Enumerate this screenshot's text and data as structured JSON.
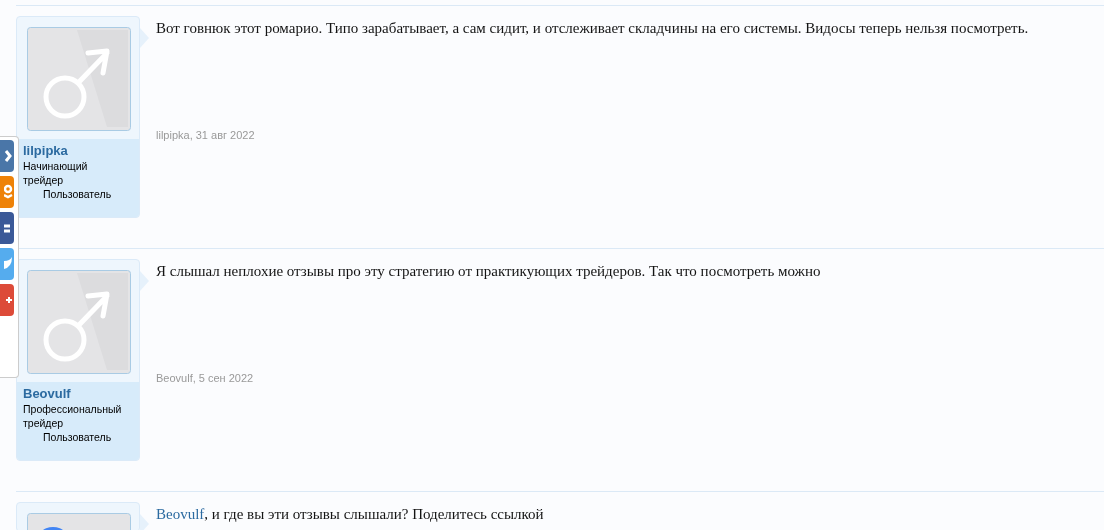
{
  "share_buttons": [
    {
      "kind": "vk",
      "color": "#4a76a8"
    },
    {
      "kind": "ok",
      "color": "#ee8208"
    },
    {
      "kind": "fb",
      "color": "#3b5998"
    },
    {
      "kind": "tw",
      "color": "#55acee"
    },
    {
      "kind": "gp",
      "color": "#dd4b39"
    }
  ],
  "posts": [
    {
      "avatar": {
        "kind": "male"
      },
      "username": "lilpipka",
      "title": "Начинающий трейдер",
      "role": "Пользователь",
      "message": "Вот говнюк этот ромарио. Типо зарабатывает, а сам сидит, и отслеживает складчины на его системы. Видосы теперь нельзя посмотреть.",
      "byline": "lilpipka, 31 авг 2022"
    },
    {
      "avatar": {
        "kind": "male"
      },
      "username": "Beovulf",
      "title": "Профессиональный трейдер",
      "role": "Пользователь",
      "message": "Я слышал неплохие отзывы про эту стратегию от практикующих трейдеров. Так что посмотреть можно",
      "byline": "Beovulf, 5 сен 2022"
    },
    {
      "avatar": {
        "kind": "circle"
      },
      "mention": "Beovulf",
      "message": ", и где вы эти отзывы слышали? Поделитесь ссылкой"
    }
  ]
}
